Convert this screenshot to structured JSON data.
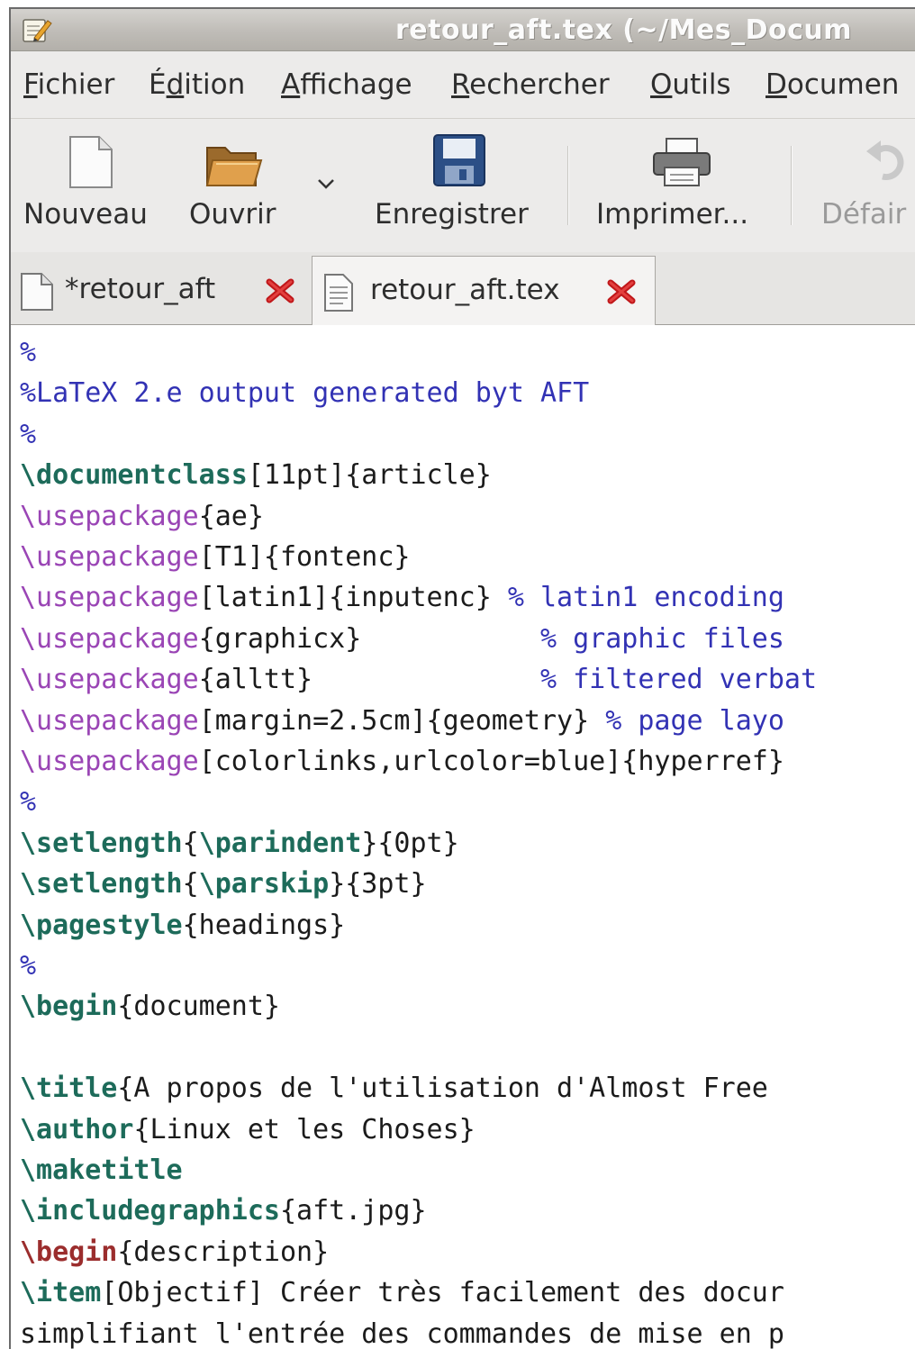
{
  "window": {
    "title": "retour_aft.tex (~/Mes_Docum"
  },
  "menubar": {
    "items": [
      {
        "mnemonic": "F",
        "rest": "ichier"
      },
      {
        "pre": "É",
        "mnemonic": "d",
        "rest": "ition"
      },
      {
        "mnemonic": "A",
        "rest": "ffichage"
      },
      {
        "mnemonic": "R",
        "rest": "echercher"
      },
      {
        "mnemonic": "O",
        "rest": "utils"
      },
      {
        "mnemonic": "D",
        "rest": "ocumen"
      }
    ]
  },
  "toolbar": {
    "new_label": "Nouveau",
    "open_label": "Ouvrir",
    "save_label": "Enregistrer",
    "print_label": "Imprimer...",
    "undo_label": "Défair"
  },
  "tabs": [
    {
      "label": "*retour_aft",
      "active": false
    },
    {
      "label": "retour_aft.tex",
      "active": true
    }
  ],
  "editor": {
    "lines": [
      [
        {
          "t": "%",
          "c": "comment"
        }
      ],
      [
        {
          "t": "%LaTeX 2.e output generated byt AFT",
          "c": "comment"
        }
      ],
      [
        {
          "t": "%",
          "c": "comment"
        }
      ],
      [
        {
          "t": "\\documentclass",
          "c": "kw"
        },
        {
          "t": "[11pt]{article}",
          "c": "plain"
        }
      ],
      [
        {
          "t": "\\usepackage",
          "c": "pkg"
        },
        {
          "t": "{ae}",
          "c": "plain"
        }
      ],
      [
        {
          "t": "\\usepackage",
          "c": "pkg"
        },
        {
          "t": "[T1]{fontenc}",
          "c": "plain"
        }
      ],
      [
        {
          "t": "\\usepackage",
          "c": "pkg"
        },
        {
          "t": "[latin1]{inputenc} ",
          "c": "plain"
        },
        {
          "t": "% latin1 encoding",
          "c": "comment"
        }
      ],
      [
        {
          "t": "\\usepackage",
          "c": "pkg"
        },
        {
          "t": "{graphicx}           ",
          "c": "plain"
        },
        {
          "t": "% graphic files",
          "c": "comment"
        }
      ],
      [
        {
          "t": "\\usepackage",
          "c": "pkg"
        },
        {
          "t": "{alltt}              ",
          "c": "plain"
        },
        {
          "t": "% filtered verbat",
          "c": "comment"
        }
      ],
      [
        {
          "t": "\\usepackage",
          "c": "pkg"
        },
        {
          "t": "[margin=2.5cm]{geometry} ",
          "c": "plain"
        },
        {
          "t": "% page layo",
          "c": "comment"
        }
      ],
      [
        {
          "t": "\\usepackage",
          "c": "pkg"
        },
        {
          "t": "[colorlinks,urlcolor=blue]{hyperref}",
          "c": "plain"
        }
      ],
      [
        {
          "t": "%",
          "c": "comment"
        }
      ],
      [
        {
          "t": "\\setlength",
          "c": "kw"
        },
        {
          "t": "{",
          "c": "plain"
        },
        {
          "t": "\\parindent",
          "c": "kw"
        },
        {
          "t": "}{0pt}",
          "c": "plain"
        }
      ],
      [
        {
          "t": "\\setlength",
          "c": "kw"
        },
        {
          "t": "{",
          "c": "plain"
        },
        {
          "t": "\\parskip",
          "c": "kw"
        },
        {
          "t": "}{3pt}",
          "c": "plain"
        }
      ],
      [
        {
          "t": "\\pagestyle",
          "c": "kw"
        },
        {
          "t": "{headings}",
          "c": "plain"
        }
      ],
      [
        {
          "t": "%",
          "c": "comment"
        }
      ],
      [
        {
          "t": "\\begin",
          "c": "kw"
        },
        {
          "t": "{document}",
          "c": "plain"
        }
      ],
      [],
      [
        {
          "t": "\\title",
          "c": "kw"
        },
        {
          "t": "{A propos de l'utilisation d'Almost Free",
          "c": "plain"
        }
      ],
      [
        {
          "t": "\\author",
          "c": "kw"
        },
        {
          "t": "{Linux et les Choses}",
          "c": "plain"
        }
      ],
      [
        {
          "t": "\\maketitle",
          "c": "kw"
        }
      ],
      [
        {
          "t": "\\includegraphics",
          "c": "kw"
        },
        {
          "t": "{aft.jpg}",
          "c": "plain"
        }
      ],
      [
        {
          "t": "\\begin",
          "c": "begin"
        },
        {
          "t": "{description}",
          "c": "plain"
        }
      ],
      [
        {
          "t": "\\item",
          "c": "kw"
        },
        {
          "t": "[Objectif] Créer très facilement des docur",
          "c": "plain"
        }
      ],
      [
        {
          "t": "simplifiant l'entrée des commandes de mise en p",
          "c": "plain"
        }
      ]
    ]
  }
}
